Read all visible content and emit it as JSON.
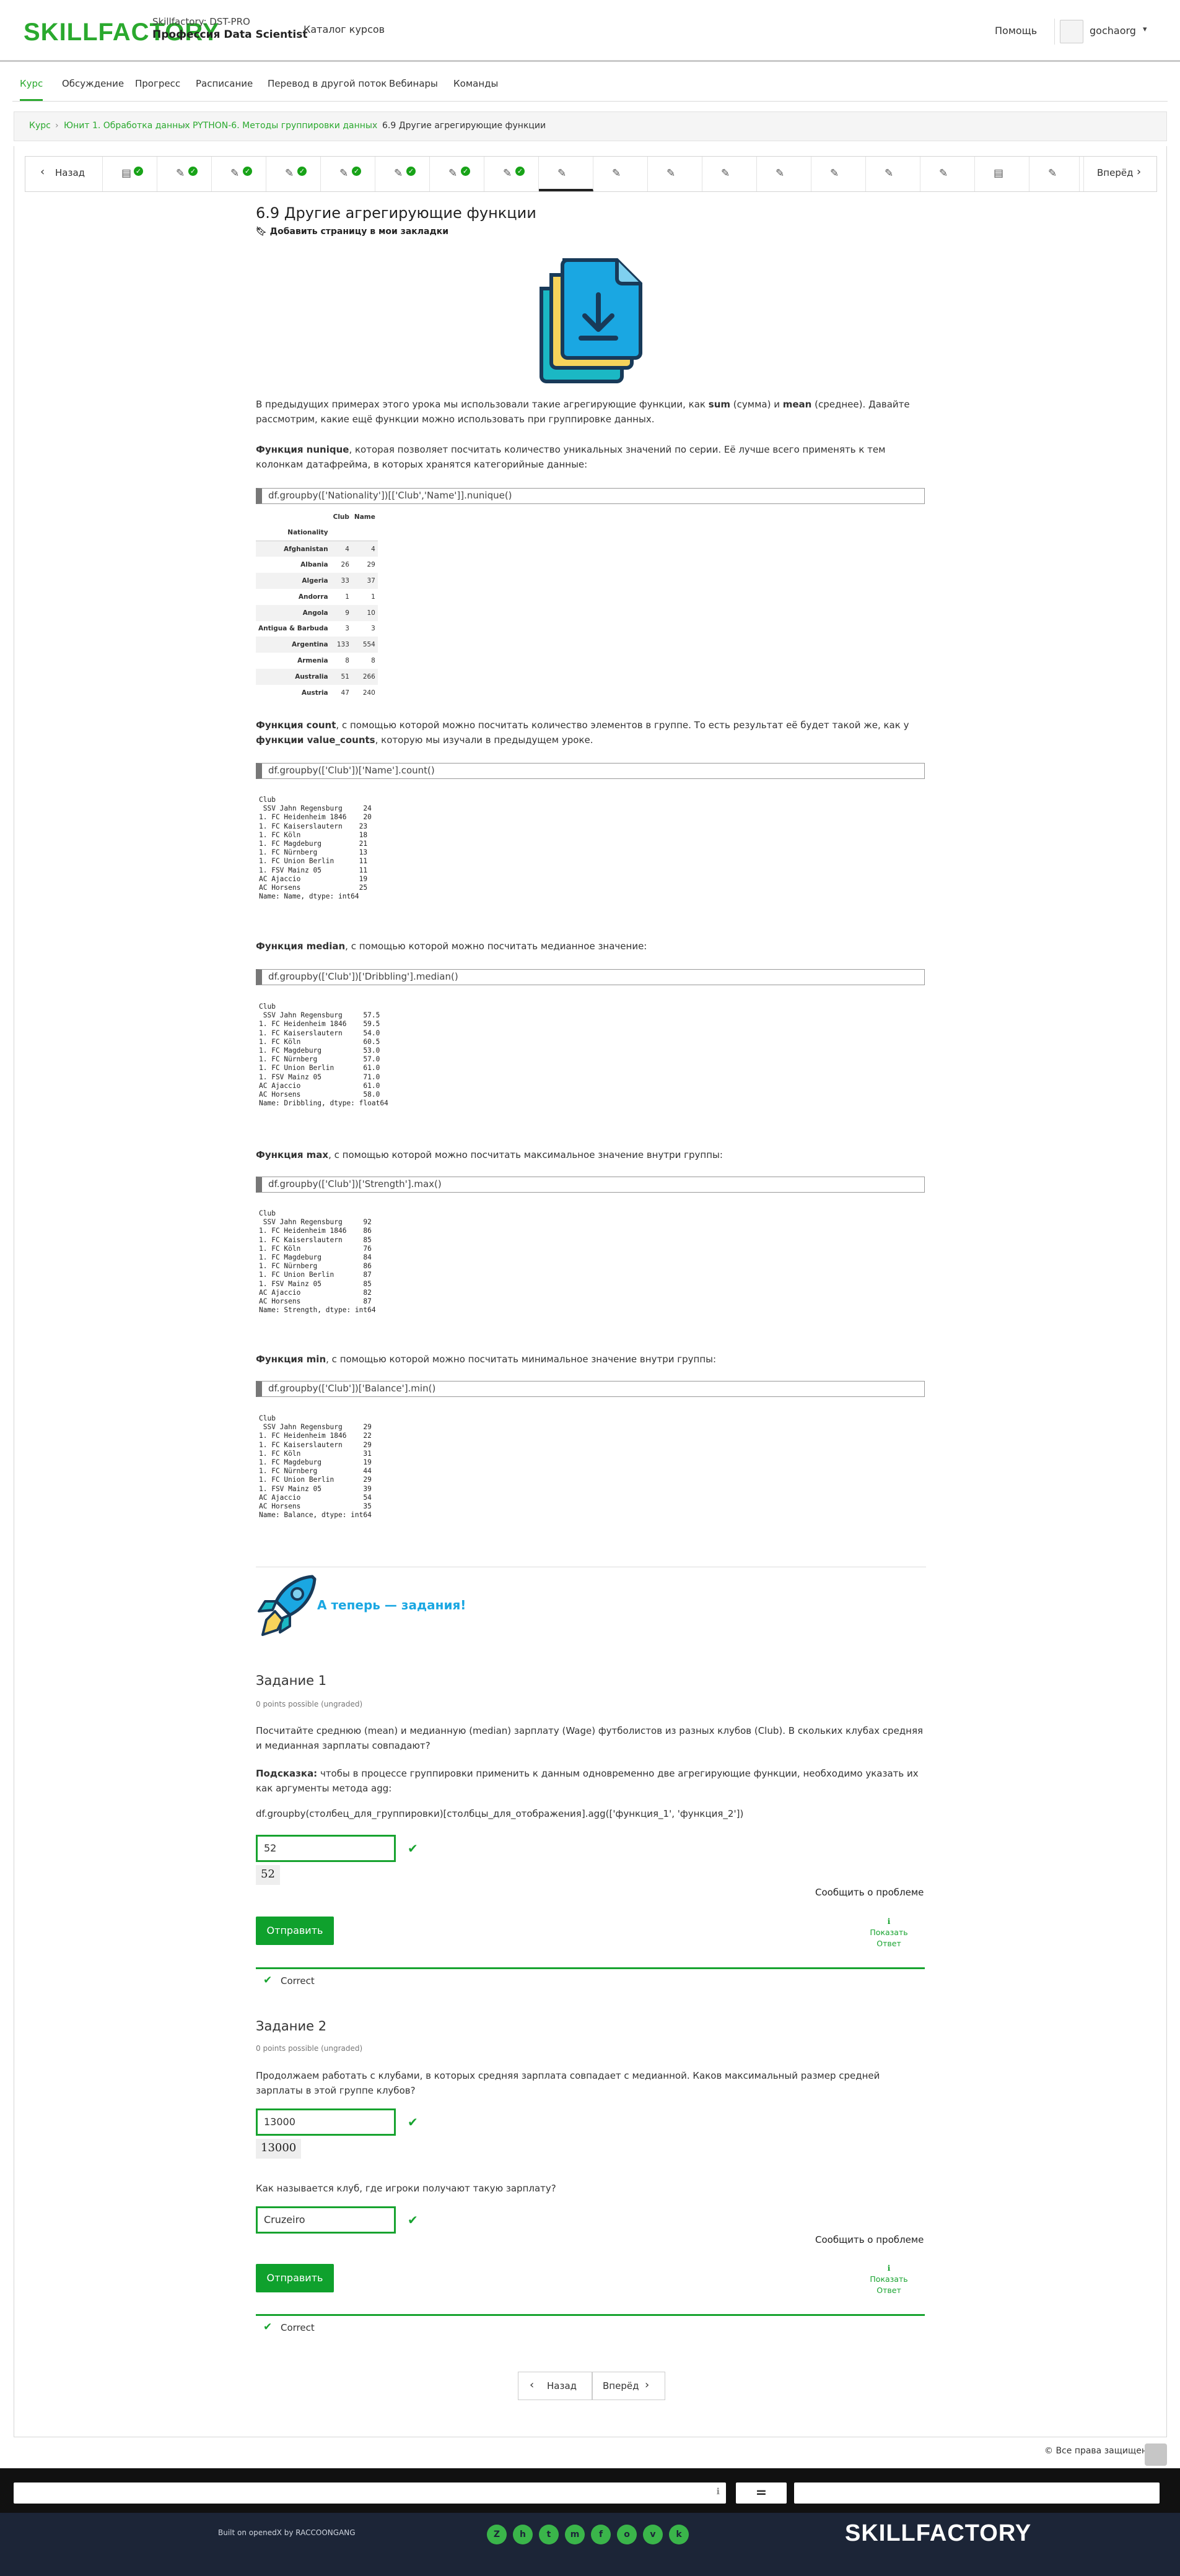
{
  "header": {
    "logo": "SKILLFACTORY",
    "program_line1": "Skillfactory: DST-PRO",
    "program_line2": "Профессия Data Scientist",
    "catalog": "Каталог курсов",
    "help": "Помощь",
    "username": "gochaorg"
  },
  "tabs": [
    "Курс",
    "Обсуждение",
    "Прогресс",
    "Расписание",
    "Перевод в другой поток",
    "Вебинары",
    "Команды"
  ],
  "breadcrumb": [
    "Курс",
    "Юнит 1. Обработка данных",
    "PYTHON-6. Методы группировки данных",
    "6.9 Другие агрегирующие функции"
  ],
  "seqnav": {
    "prev": "Назад",
    "next": "Вперёд"
  },
  "page": {
    "title": "6.9 Другие агрегирующие функции",
    "bookmark": "Добавить страницу в мои закладки",
    "intro_a": "В предыдущих примерах этого урока мы использовали такие агрегирующие функции, как ",
    "intro_sum": "sum",
    "intro_b": " (сумма) и ",
    "intro_mean": "mean",
    "intro_c": " (среднее). Давайте рассмотрим, какие ещё функции можно использовать при группировке данных.",
    "nunique_h": "Функция nunique",
    "nunique_t": ", которая позволяет посчитать количество уникальных значений по серии. Её лучше всего применять к тем колонкам датафрейма, в которых хранятся категорийные данные:",
    "code1": "df.groupby(['Nationality'])[['Club','Name']].nunique()",
    "count_h": "Функция count",
    "count_t1": ", с помощью которой можно посчитать количество элементов в группе. То есть результат её будет такой же, как у ",
    "count_h2": "функции value_counts",
    "count_t2": ", которую мы изучали в предыдущем уроке.",
    "code2": "df.groupby(['Club'])['Name'].count()",
    "median_h": "Функция median",
    "median_t": ", с помощью которой можно посчитать медианное значение:",
    "code3": "df.groupby(['Club'])['Dribbling'].median()",
    "max_h": "Функция max",
    "max_t": ", с помощью которой можно посчитать максимальное значение внутри группы:",
    "code4": "df.groupby(['Club'])['Strength'].max()",
    "min_h": "Функция min",
    "min_t": ", с помощью которой можно посчитать минимальное значение внутри группы:",
    "code5": "df.groupby(['Club'])['Balance'].min()",
    "tasks_banner": "А теперь — задания!"
  },
  "table": {
    "cols": [
      "Club",
      "Name"
    ],
    "index_name": "Nationality",
    "rows": [
      [
        "Afghanistan",
        "4",
        "4"
      ],
      [
        "Albania",
        "26",
        "29"
      ],
      [
        "Algeria",
        "33",
        "37"
      ],
      [
        "Andorra",
        "1",
        "1"
      ],
      [
        "Angola",
        "9",
        "10"
      ],
      [
        "Antigua & Barbuda",
        "3",
        "3"
      ],
      [
        "Argentina",
        "133",
        "554"
      ],
      [
        "Armenia",
        "8",
        "8"
      ],
      [
        "Australia",
        "51",
        "266"
      ],
      [
        "Austria",
        "47",
        "240"
      ]
    ]
  },
  "outputs": {
    "count": "Club\n SSV Jahn Regensburg     24\n1. FC Heidenheim 1846    20\n1. FC Kaiserslautern    23\n1. FC Köln              18\n1. FC Magdeburg         21\n1. FC Nürnberg          13\n1. FC Union Berlin      11\n1. FSV Mainz 05         11\nAC Ajaccio              19\nAC Horsens              25\nName: Name, dtype: int64",
    "median": "Club\n SSV Jahn Regensburg     57.5\n1. FC Heidenheim 1846    59.5\n1. FC Kaiserslautern     54.0\n1. FC Köln               60.5\n1. FC Magdeburg          53.0\n1. FC Nürnberg           57.0\n1. FC Union Berlin       61.0\n1. FSV Mainz 05          71.0\nAC Ajaccio               61.0\nAC Horsens               58.0\nName: Dribbling, dtype: float64",
    "max": "Club\n SSV Jahn Regensburg     92\n1. FC Heidenheim 1846    86\n1. FC Kaiserslautern     85\n1. FC Köln               76\n1. FC Magdeburg          84\n1. FC Nürnberg           86\n1. FC Union Berlin       87\n1. FSV Mainz 05          85\nAC Ajaccio               82\nAC Horsens               87\nName: Strength, dtype: int64",
    "min": "Club\n SSV Jahn Regensburg     29\n1. FC Heidenheim 1846    22\n1. FC Kaiserslautern     29\n1. FC Köln               31\n1. FC Magdeburg          19\n1. FC Nürnberg           44\n1. FC Union Berlin       29\n1. FSV Mainz 05          39\nAC Ajaccio               54\nAC Horsens               35\nName: Balance, dtype: int64"
  },
  "task1": {
    "title": "Задание 1",
    "points": "0 points possible (ungraded)",
    "question": "Посчитайте среднюю (mean) и медианную (median) зарплату (Wage) футболистов из разных клубов (Club). В скольких клубах средняя и медианная зарплаты совпадают?",
    "hint_h": "Подсказка:",
    "hint_t": " чтобы в процессе группировки применить к данным одновременно две агрегирующие функции, необходимо указать их как аргументы метода agg:",
    "hint_code": "df.groupby(столбец_для_группировки)[столбцы_для_отображения].agg(['функция_1', 'функция_2'])",
    "input_value": "52",
    "answer": "52",
    "report": "Сообщить о проблеме",
    "submit": "Отправить",
    "show1": "Показать",
    "show2": "Ответ",
    "status": "Correct"
  },
  "task2": {
    "title": "Задание 2",
    "points": "0 points possible (ungraded)",
    "question": "Продолжаем работать с клубами, в которых средняя зарплата совпадает с медианной. Каков максимальный размер средней зарплаты в этой группе клубов?",
    "input_value": "13000",
    "answer": "13000",
    "question2": "Как называется клуб, где игроки получают такую зарплату?",
    "input2_value": "Cruzeiro",
    "report": "Сообщить о проблеме",
    "submit": "Отправить",
    "show1": "Показать",
    "show2": "Ответ",
    "status": "Correct"
  },
  "bottom_nav": {
    "prev": "Назад",
    "next": "Вперёд"
  },
  "footer": {
    "copyright": "© Все права защищены",
    "built": "Built on openedX by RACCOONGANG",
    "eq": "=",
    "logo": "SKILLFACTORY",
    "social": [
      "Z",
      "h",
      "t",
      "m",
      "f",
      "o",
      "v",
      "k"
    ]
  },
  "colors": {
    "brand": "#2aa92e",
    "accent_blue": "#1aa7e2",
    "footer_bg": "#1c2537"
  }
}
